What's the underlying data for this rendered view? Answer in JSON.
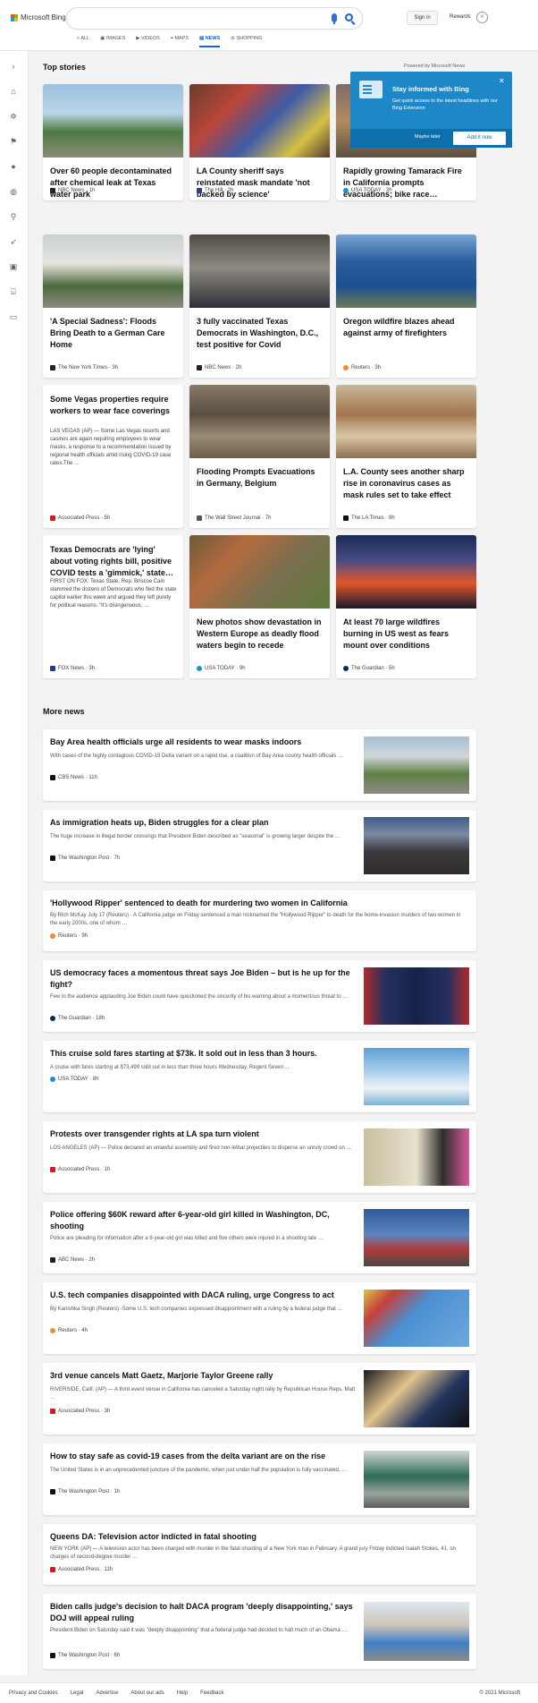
{
  "header": {
    "brand": "Microsoft Bing",
    "search_value": "",
    "signin": "Sign in",
    "rewards": "Rewards",
    "nav": [
      {
        "label": "ALL",
        "icon": "search-icon"
      },
      {
        "label": "IMAGES",
        "icon": "image-icon"
      },
      {
        "label": "VIDEOS",
        "icon": "video-icon"
      },
      {
        "label": "MAPS",
        "icon": "map-pin-icon"
      },
      {
        "label": "NEWS",
        "icon": "news-icon",
        "active": true
      },
      {
        "label": "SHOPPING",
        "icon": "tag-icon"
      }
    ]
  },
  "sidebar": {
    "icons": [
      "expand-icon",
      "home-icon",
      "virus-icon",
      "flag-icon",
      "location-icon",
      "globe-icon",
      "microscope-icon",
      "rocket-icon",
      "video-icon",
      "bank-icon",
      "card-icon"
    ]
  },
  "top_stories": {
    "heading": "Top stories",
    "powered_by": "Powered by Microsoft News",
    "cards": [
      {
        "title": "Over 60 people decontaminated after chemical leak at Texas water park",
        "source": "NBC News · 1h",
        "pub_color": "#222222"
      },
      {
        "title": "LA County sheriff says reinstated mask mandate 'not backed by science'",
        "source": "The Hill · 2h",
        "pub_color": "#2b3e8c"
      },
      {
        "title": "Rapidly growing Tamarack Fire in California prompts evacuations; bike race…",
        "source": "USA TODAY · 3h",
        "pub_color": "#1a8fe0"
      },
      {
        "title": "'A Special Sadness': Floods Bring Death to a German Care Home",
        "source": "The New York Times · 3h",
        "pub_color": "#222222"
      },
      {
        "title": "3 fully vaccinated Texas Democrats in Washington, D.C., test positive for Covid",
        "source": "NBC News · 2h",
        "pub_color": "#222222"
      },
      {
        "title": "Oregon wildfire blazes ahead against army of firefighters",
        "source": "Reuters · 3h",
        "pub_color": "#f28a30"
      },
      {
        "title": "Some Vegas properties require workers to wear face coverings",
        "snippet": "LAS VEGAS (AP) — Some Las Vegas resorts and casinos are again requiring employees to wear masks, a response to a recommendation issued by regional health officials amid rising COVID-19 case rates.The …",
        "source": "Associated Press · 5h",
        "pub_color": "#d01c1c"
      },
      {
        "title": "Flooding Prompts Evacuations in Germany, Belgium",
        "source": "The Wall Street Journal · 7h",
        "pub_color": "#555555"
      },
      {
        "title": "L.A. County sees another sharp rise in coronavirus cases as mask rules set to take effect",
        "source": "The LA Times · 8h",
        "pub_color": "#111111"
      },
      {
        "title": "Texas Democrats are 'lying' about voting rights bill, positive COVID tests a 'gimmick,' state…",
        "snippet": "FIRST ON FOX: Texas State. Rep. Briscoe Cain slammed the dozens of Democrats who fled the state capitol earlier this week and argued they left purely for political reasons. \"It's disingenuous, …",
        "source": "FOX News · 3h",
        "pub_color": "#1f3b8a"
      },
      {
        "title": "New photos show devastation in Western Europe as deadly flood waters begin to recede",
        "source": "USA TODAY · 9h",
        "pub_color": "#1a8fe0"
      },
      {
        "title": "At least 70 large wildfires burning in US west as fears mount over conditions",
        "source": "The Guardian · 5h",
        "pub_color": "#0b2a5c"
      }
    ]
  },
  "popup": {
    "heading": "Stay informed with Bing",
    "text": "Get quick access to the latest headlines with our Bing Extension",
    "later": "Maybe later",
    "add": "Add it now"
  },
  "more_news": {
    "heading": "More news",
    "items": [
      {
        "title": "Bay Area health officials urge all residents to wear masks indoors",
        "snippet": "With cases of the highly contagious COVID-19 Delta variant on a rapid rise, a coalition of Bay Area county health officials …",
        "source": "CBS News · 11h",
        "pub_color": "#111111"
      },
      {
        "title": "As immigration heats up, Biden struggles for a clear plan",
        "snippet": "The huge increase in illegal border crossings that President Biden described as \"seasonal\" is growing larger despite the …",
        "source": "The Washington Post · 7h",
        "pub_color": "#111111"
      },
      {
        "title": "'Hollywood Ripper' sentenced to death for murdering two women in California",
        "snippet": "By Rich McKay July 17 (Reuters) - A California judge on Friday sentenced a man nicknamed the \"Hollywood Ripper\" to death for the home-invasion murders of two women in the early 2000s, one of whom …",
        "source": "Reuters · 9h",
        "pub_color": "#f28a30"
      },
      {
        "title": "US democracy faces a momentous threat says Joe Biden – but is he up for the fight?",
        "snippet": "Few in the audience applauding Joe Biden could have questioned the sincerity of his warning about a momentous threat to …",
        "source": "The Guardian · 18h",
        "pub_color": "#0b2a5c"
      },
      {
        "title": "This cruise sold fares starting at $73k. It sold out in less than 3 hours.",
        "snippet": "A cruise with fares starting at $73,499 sold out in less than three hours Wednesday. Regent Seven …",
        "source": "USA TODAY · 8h",
        "pub_color": "#1a8fe0"
      },
      {
        "title": "Protests over transgender rights at LA spa turn violent",
        "snippet": "LOS ANGELES (AP) — Police declared an unlawful assembly and fired non-lethal projectiles to disperse an unruly crowd on …",
        "source": "Associated Press · 1h",
        "pub_color": "#d01c1c"
      },
      {
        "title": "Police offering $60K reward after 6-year-old girl killed in Washington, DC, shooting",
        "snippet": "Police are pleading for information after a 6-year-old girl was killed and five others were injured in a shooting late …",
        "source": "ABC News · 2h",
        "pub_color": "#222222"
      },
      {
        "title": "U.S. tech companies disappointed with DACA ruling, urge Congress to act",
        "snippet": "By Kanishka Singh (Reuters) -Some U.S. tech companies expressed disappointment with a ruling by a federal judge that …",
        "source": "Reuters · 4h",
        "pub_color": "#f28a30"
      },
      {
        "title": "3rd venue cancels Matt Gaetz, Marjorie Taylor Greene rally",
        "snippet": "RIVERSIDE, Calif. (AP) — A third event venue in California has canceled a Saturday night rally by Republican House Reps. Matt …",
        "source": "Associated Press · 3h",
        "pub_color": "#d01c1c"
      },
      {
        "title": "How to stay safe as covid-19 cases from the delta variant are on the rise",
        "snippet": "The United States is in an unprecedented juncture of the pandemic, when just under half the population is fully vaccinated, …",
        "source": "The Washington Post · 1h",
        "pub_color": "#111111"
      },
      {
        "title": "Queens DA: Television actor indicted in fatal shooting",
        "snippet": "NEW YORK (AP) — A television actor has been charged with murder in the fatal shooting of a New York man in February. A grand jury Friday indicted Isaiah Stokes, 41, on charges of second-degree murder …",
        "source": "Associated Press · 11h",
        "pub_color": "#d01c1c"
      },
      {
        "title": "Biden calls judge's decision to halt DACA program 'deeply disappointing,' says DOJ will appeal ruling",
        "snippet": "President Biden on Saturday said it was \"deeply disappointing\" that a federal judge had decided to halt much of an Obama …",
        "source": "The Washington Post · 6h",
        "pub_color": "#111111"
      }
    ]
  },
  "footer": {
    "links": [
      "Privacy and Cookies",
      "Legal",
      "Advertise",
      "About our ads",
      "Help",
      "Feedback"
    ],
    "copyright": "© 2021 Microsoft"
  }
}
